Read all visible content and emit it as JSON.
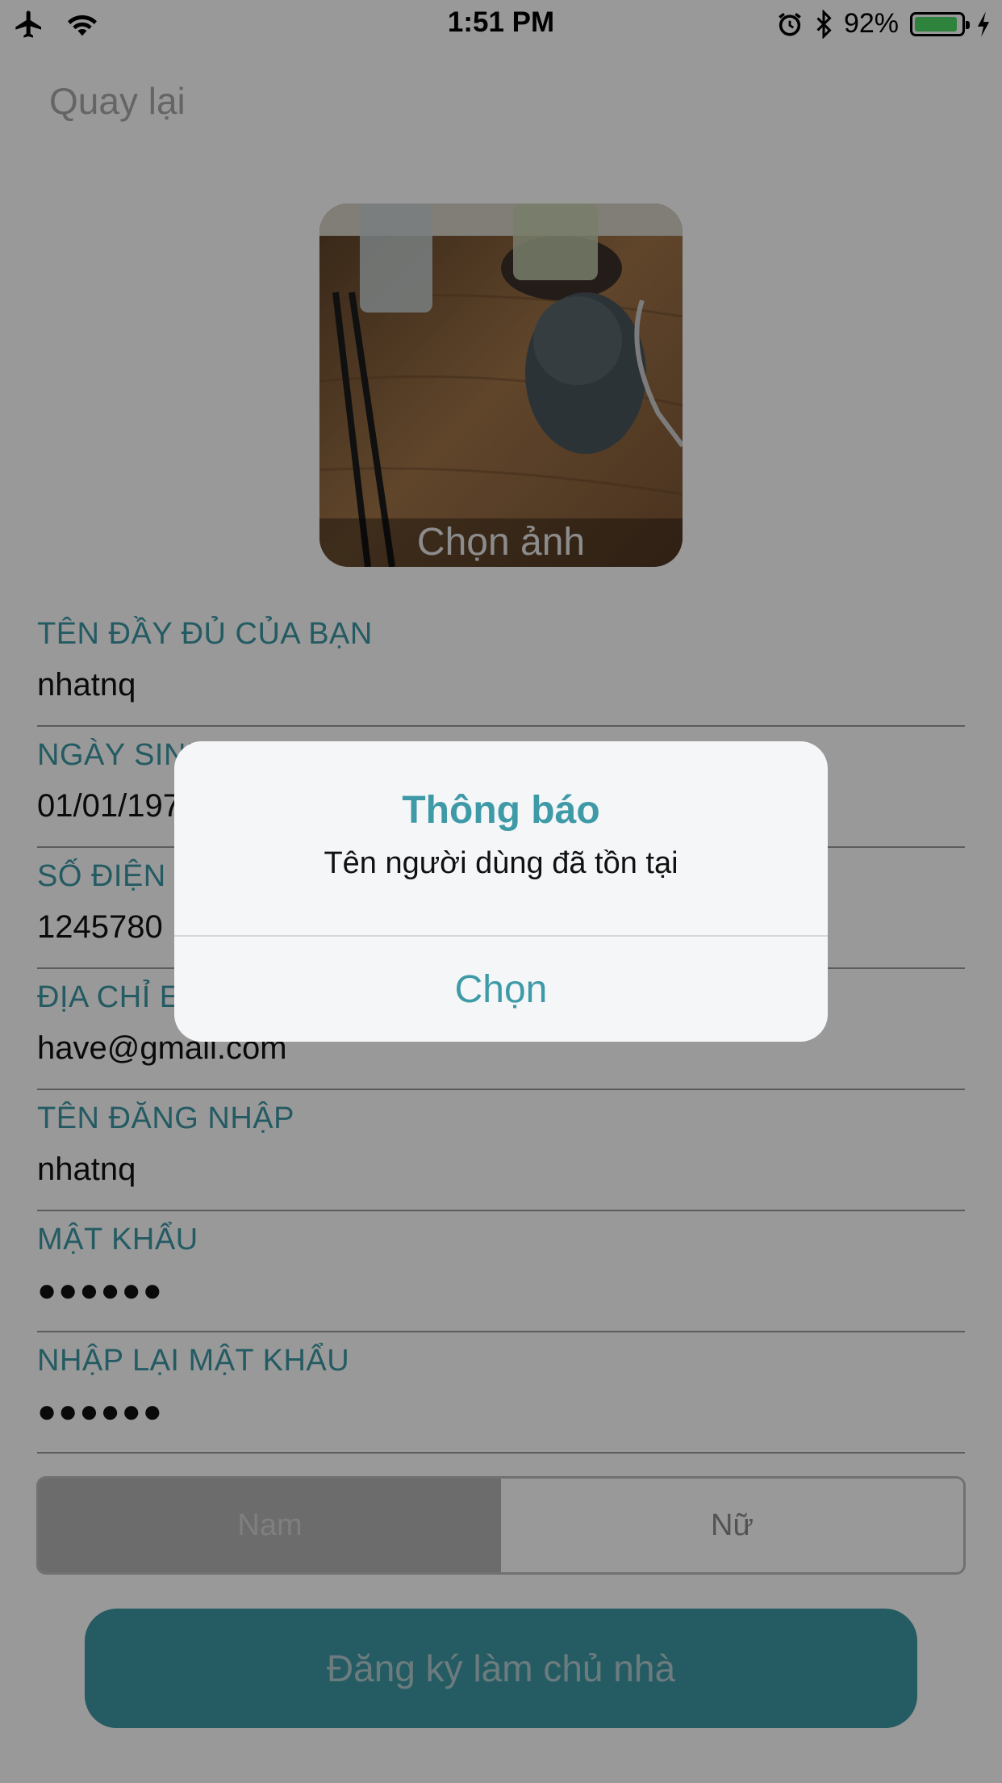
{
  "status_bar": {
    "time": "1:51 PM",
    "battery_text": "92%",
    "battery_level": 0.92,
    "icons": [
      "airplane-icon",
      "wifi-icon",
      "alarm-icon",
      "bluetooth-icon",
      "battery-icon",
      "charging-icon"
    ]
  },
  "nav": {
    "back_label": "Quay lại"
  },
  "avatar": {
    "choose_label": "Chọn ảnh"
  },
  "form": {
    "fields": [
      {
        "label": "TÊN ĐẦY ĐỦ CỦA BẠN",
        "value": "nhatnq"
      },
      {
        "label": "NGÀY SINH",
        "value": "01/01/1970"
      },
      {
        "label": "SỐ ĐIỆN THOẠI",
        "value": "1245780"
      },
      {
        "label": "ĐỊA CHỈ EMAIL",
        "value": "have@gmail.com"
      },
      {
        "label": "TÊN ĐĂNG NHẬP",
        "value": "nhatnq"
      },
      {
        "label": "MẬT KHẨU",
        "value": "●●●●●●"
      },
      {
        "label": "NHẬP LẠI MẬT KHẨU",
        "value": "●●●●●●"
      }
    ]
  },
  "gender": {
    "options": [
      "Nam",
      "Nữ"
    ],
    "selected": "Nam"
  },
  "submit_label": "Đăng ký làm chủ nhà",
  "alert": {
    "title": "Thông báo",
    "message": "Tên người dùng đã tồn tại",
    "button": "Chọn"
  },
  "colors": {
    "accent": "#3e9aa6",
    "battery": "#4cd964"
  }
}
